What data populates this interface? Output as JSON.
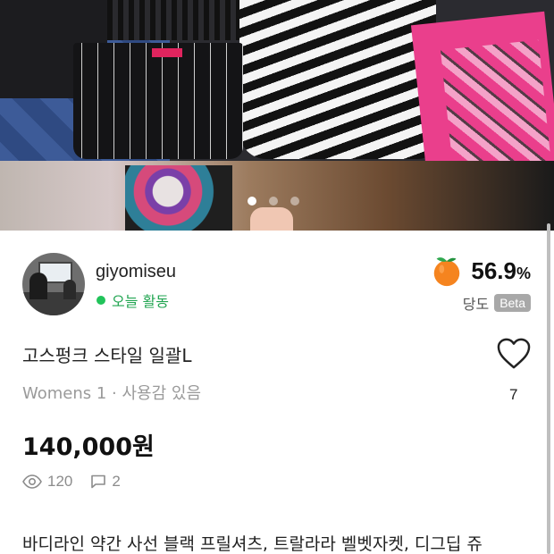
{
  "gallery": {
    "total_images": 3,
    "active_index": 0
  },
  "seller": {
    "username": "giyomiseu",
    "status": "오늘 활동",
    "status_color": "#21c35a",
    "avatar_icon": "avatar-photo",
    "manner_temperature": "56.9",
    "manner_unit": "%",
    "sweetness_label": "당도",
    "beta_badge": "Beta",
    "temp_icon": "orange-icon"
  },
  "product": {
    "title": "고스펑크 스타일 일괄L",
    "meta": "Womens 1 · 사용감 있음",
    "like_count": "7",
    "like_icon": "heart-icon",
    "price": "140,000원",
    "views": "120",
    "chats": "2",
    "description_preview": "바디라인 약간 사선 블랙 프릴셔츠, 트랄라라 벨벳자켓, 디그딥 쥬"
  }
}
